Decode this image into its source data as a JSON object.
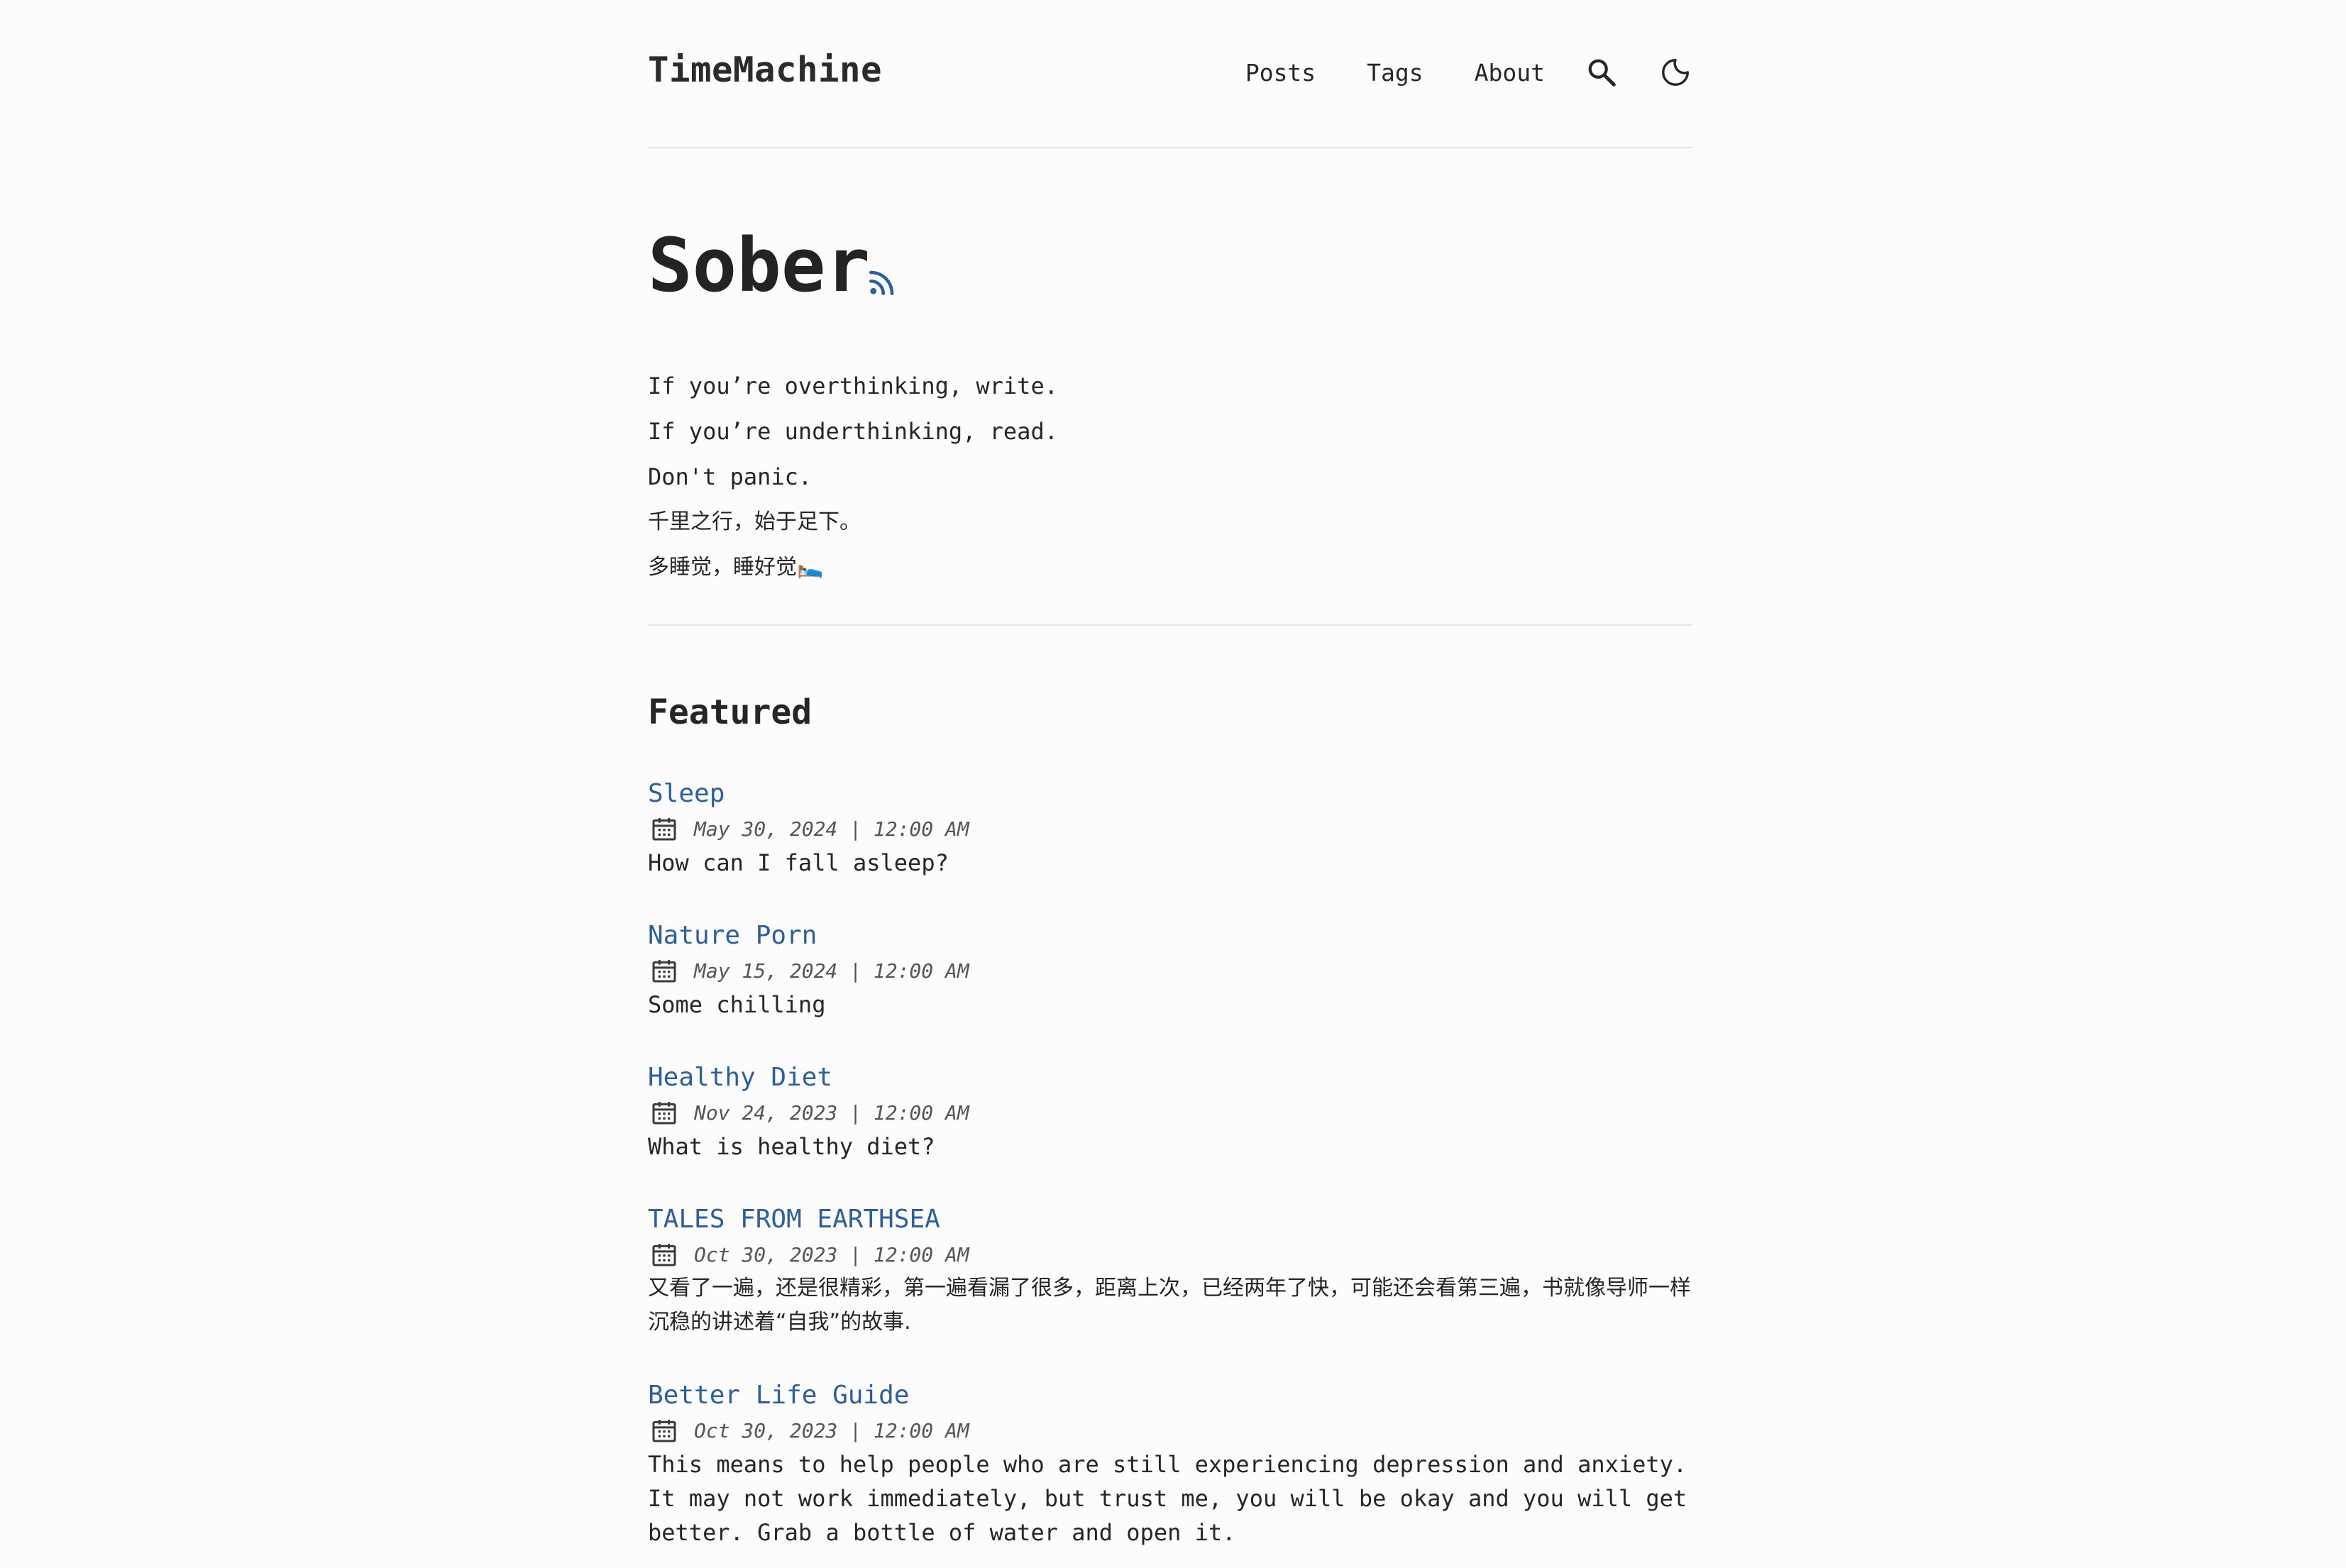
{
  "header": {
    "site_title": "TimeMachine",
    "nav": [
      "Posts",
      "Tags",
      "About"
    ],
    "search_icon": "search-icon",
    "theme_icon": "moon-icon"
  },
  "hero": {
    "title": "Sober",
    "rss_icon": "rss-icon",
    "lines": [
      "If you’re overthinking, write.",
      "If you’re underthinking, read.",
      "Don't panic.",
      "千里之行，始于足下。",
      "多睡觉，睡好觉🛌"
    ]
  },
  "featured": {
    "heading": "Featured",
    "posts": [
      {
        "title": "Sleep",
        "date": "May 30, 2024 | 12:00 AM",
        "description": "How can I fall asleep?"
      },
      {
        "title": "Nature Porn",
        "date": "May 15, 2024 | 12:00 AM",
        "description": "Some chilling"
      },
      {
        "title": "Healthy Diet",
        "date": "Nov 24, 2023 | 12:00 AM",
        "description": "What is healthy diet?"
      },
      {
        "title": "TALES FROM EARTHSEA",
        "date": "Oct 30, 2023 | 12:00 AM",
        "description": "又看了一遍，还是很精彩，第一遍看漏了很多，距离上次，已经两年了快，可能还会看第三遍，书就像导师一样沉稳的讲述着“自我”的故事."
      },
      {
        "title": "Better Life Guide",
        "date": "Oct 30, 2023 | 12:00 AM",
        "description": "This means to help people who are still experiencing depression and anxiety. It may not work immediately, but trust me, you will be okay and you will get better. Grab a bottle of water and open it."
      }
    ]
  },
  "colors": {
    "background": "#fbfcfb",
    "link": "#2c5f9f",
    "text": "#262626",
    "divider": "#e3e4e3"
  }
}
